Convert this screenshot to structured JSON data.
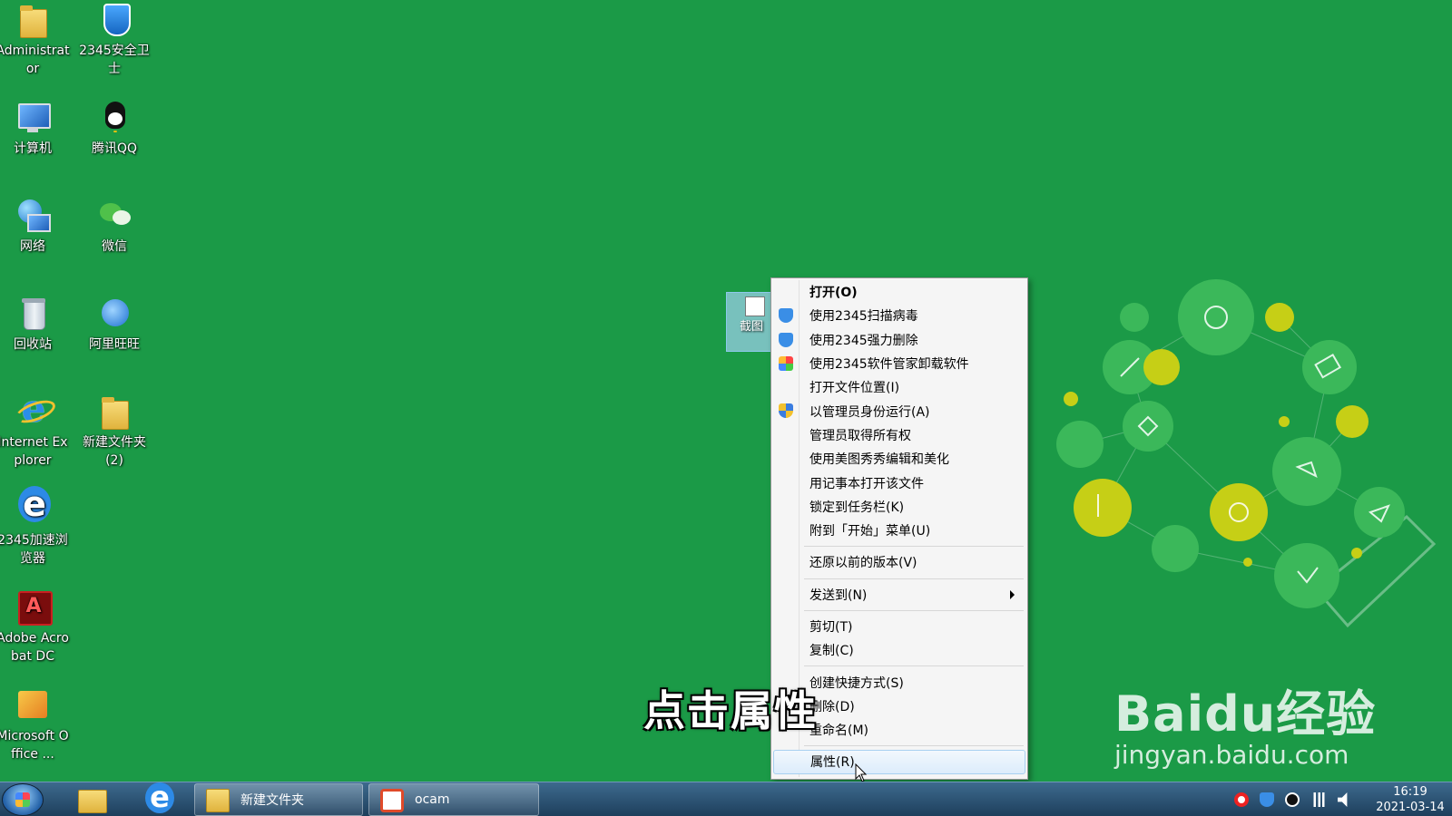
{
  "desktop": {
    "icons": [
      {
        "label": "Administrat or"
      },
      {
        "label": "2345安全卫士"
      },
      {
        "label": "计算机"
      },
      {
        "label": "腾讯QQ"
      },
      {
        "label": "网络"
      },
      {
        "label": "微信"
      },
      {
        "label": "回收站"
      },
      {
        "label": "阿里旺旺"
      },
      {
        "label": "Internet Explorer"
      },
      {
        "label": "新建文件夹 (2)"
      },
      {
        "label": "2345加速浏览器"
      },
      {
        "label": "Adobe Acrobat DC"
      },
      {
        "label": "Microsoft Office ..."
      }
    ],
    "selected_shortcut_label": "截图"
  },
  "context_menu": {
    "items": [
      {
        "label": "打开(O)"
      },
      {
        "label": "使用2345扫描病毒"
      },
      {
        "label": "使用2345强力删除"
      },
      {
        "label": "使用2345软件管家卸载软件"
      },
      {
        "label": "打开文件位置(I)"
      },
      {
        "label": "以管理员身份运行(A)"
      },
      {
        "label": "管理员取得所有权"
      },
      {
        "label": "使用美图秀秀编辑和美化"
      },
      {
        "label": "用记事本打开该文件"
      },
      {
        "label": "锁定到任务栏(K)"
      },
      {
        "label": "附到「开始」菜单(U)"
      },
      {
        "label": "还原以前的版本(V)"
      },
      {
        "label": "发送到(N)"
      },
      {
        "label": "剪切(T)"
      },
      {
        "label": "复制(C)"
      },
      {
        "label": "创建快捷方式(S)"
      },
      {
        "label": "删除(D)"
      },
      {
        "label": "重命名(M)"
      },
      {
        "label": "属性(R)"
      }
    ]
  },
  "caption": "点击属性",
  "watermark": {
    "line1": "Baidu经验",
    "line2": "jingyan.baidu.com"
  },
  "taskbar": {
    "buttons": [
      {
        "label": "新建文件夹"
      },
      {
        "label": "ocam"
      }
    ],
    "clock": {
      "time": "16:19",
      "date": "2021-03-14"
    }
  },
  "colors": {
    "desktop_bg": "#1b9a47",
    "menu_bg": "#f5f5f5",
    "taskbar": "#2a5275"
  }
}
